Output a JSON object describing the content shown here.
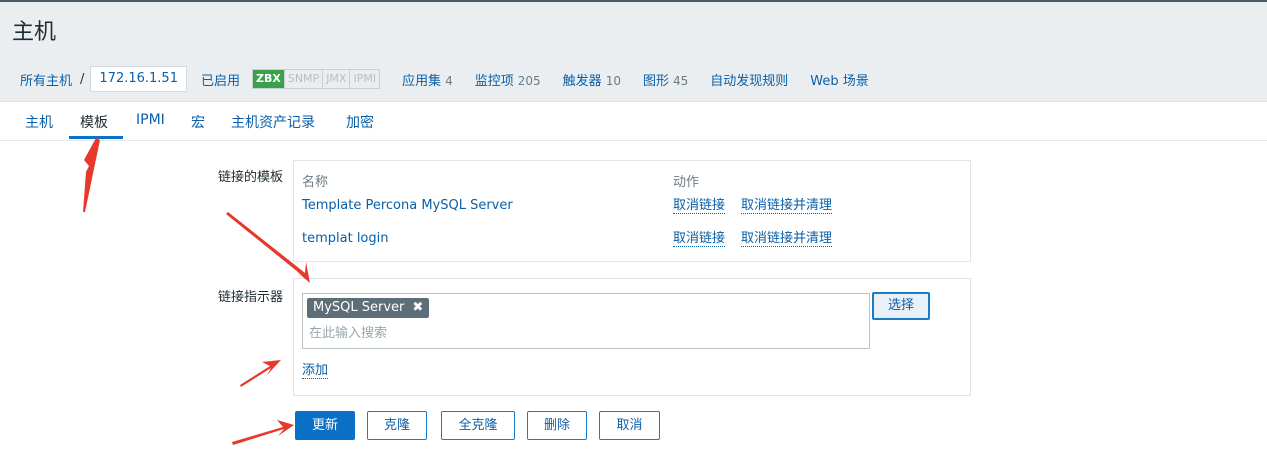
{
  "page": {
    "title": "主机"
  },
  "breadcrumb": {
    "all_hosts": "所有主机",
    "separator": "/",
    "host": "172.16.1.51",
    "status": "已启用",
    "availability": [
      "ZBX",
      "SNMP",
      "JMX",
      "IPMI"
    ],
    "links": [
      {
        "label": "应用集",
        "count": "4"
      },
      {
        "label": "监控项",
        "count": "205"
      },
      {
        "label": "触发器",
        "count": "10"
      },
      {
        "label": "图形",
        "count": "45"
      },
      {
        "label": "自动发现规则",
        "count": ""
      },
      {
        "label": "Web 场景",
        "count": ""
      }
    ]
  },
  "tabs": [
    "主机",
    "模板",
    "IPMI",
    "宏",
    "主机资产记录",
    "加密"
  ],
  "active_tab": "模板",
  "linked_templates": {
    "label": "链接的模板",
    "col_name": "名称",
    "col_action": "动作",
    "rows": [
      {
        "name": "Template Percona MySQL Server",
        "unlink": "取消链接",
        "unlink_clear": "取消链接并清理"
      },
      {
        "name": "templat login",
        "unlink": "取消链接",
        "unlink_clear": "取消链接并清理"
      }
    ]
  },
  "link_new": {
    "label": "链接指示器",
    "selected": "MySQL Server",
    "remove_icon": "✖",
    "placeholder": "在此输入搜索",
    "select_button": "选择",
    "add_link": "添加"
  },
  "buttons": {
    "update": "更新",
    "clone": "克隆",
    "full_clone": "全克隆",
    "delete": "删除",
    "cancel": "取消"
  },
  "colors": {
    "link": "#0a5fa8",
    "primary": "#0a71c7",
    "annotation": "#e8372b",
    "enabled": "#2a9d2a"
  }
}
